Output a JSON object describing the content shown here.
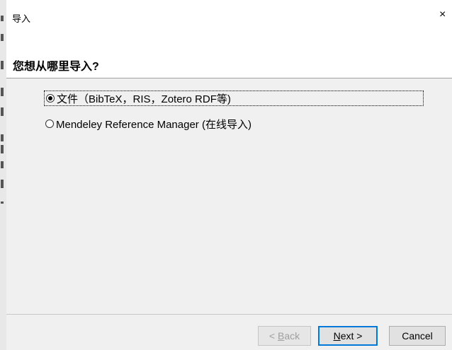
{
  "dialog": {
    "title": "导入",
    "close_glyph": "×",
    "heading": "您想从哪里导入?"
  },
  "options": [
    {
      "label": "文件（BibTeX，RIS，Zotero RDF等)",
      "checked": true
    },
    {
      "label": "Mendeley Reference Manager (在线导入)",
      "checked": false
    }
  ],
  "buttons": {
    "back": {
      "prefix": "< ",
      "mnemonic": "B",
      "rest": "ack"
    },
    "next": {
      "mnemonic": "N",
      "rest": "ext >"
    },
    "cancel": "Cancel"
  }
}
